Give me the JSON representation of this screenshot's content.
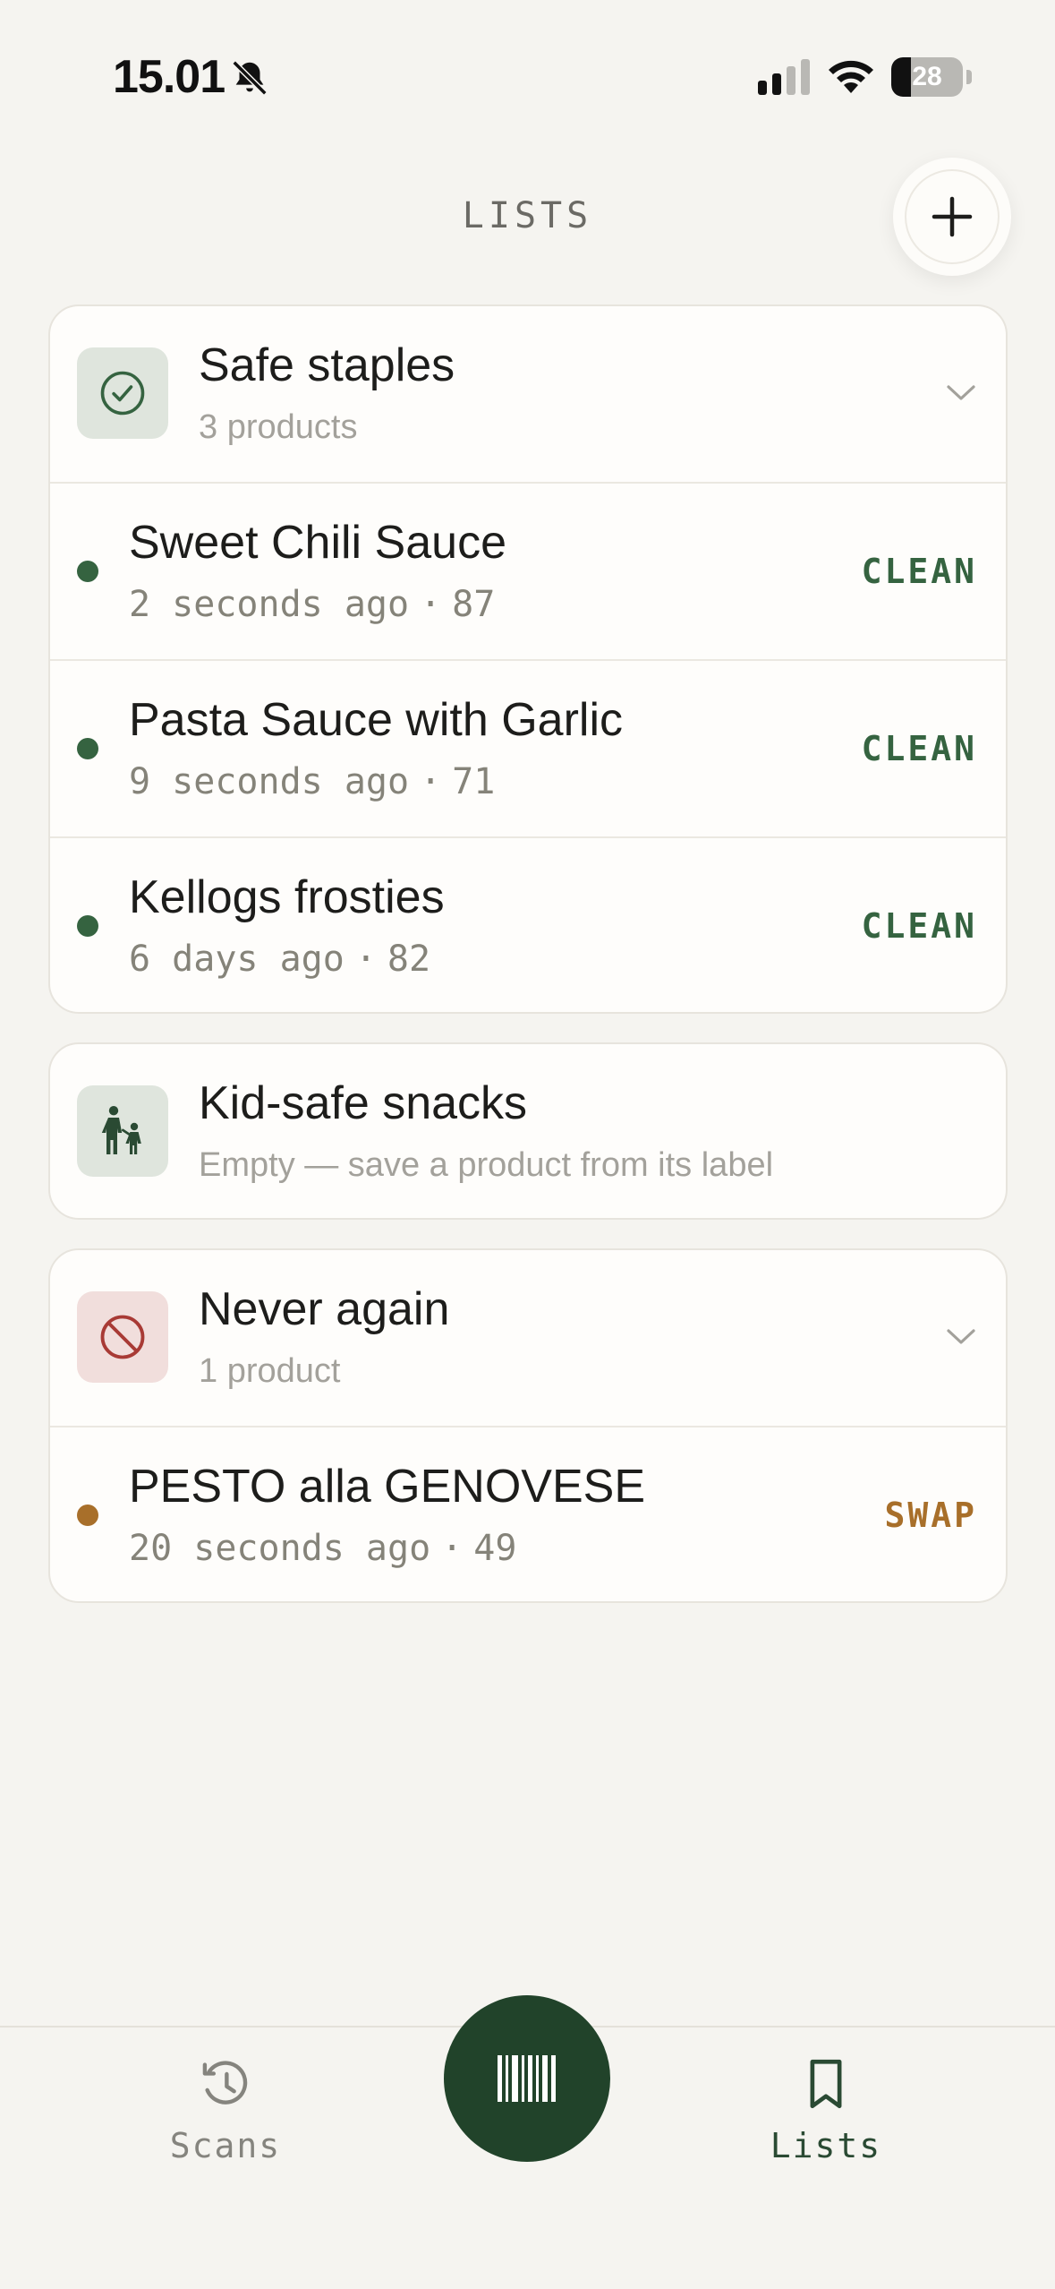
{
  "status_bar": {
    "time": "15.01",
    "battery_level": "28",
    "battery_fraction": 0.28,
    "icons": [
      "bell-slash-icon",
      "cellular-signal-icon",
      "wifi-icon",
      "battery-icon"
    ]
  },
  "header": {
    "title": "LISTS",
    "add_icon": "plus-icon"
  },
  "lists": [
    {
      "name": "Safe staples",
      "subtitle": "3 products",
      "icon": "check-circle-icon",
      "accent": "#356340",
      "expanded": true,
      "products": [
        {
          "name": "Sweet Chili Sauce",
          "time": "2 seconds ago",
          "separator": "·",
          "score": "87",
          "verdict": "CLEAN"
        },
        {
          "name": "Pasta Sauce with Garlic",
          "time": "9 seconds ago",
          "separator": "·",
          "score": "71",
          "verdict": "CLEAN"
        },
        {
          "name": "Kellogs frosties",
          "time": "6 days ago",
          "separator": "·",
          "score": "82",
          "verdict": "CLEAN"
        }
      ]
    },
    {
      "name": "Kid-safe snacks",
      "subtitle": "Empty — save a product from its label",
      "icon": "parent-child-icon",
      "accent": "#2a4a33",
      "expanded": false,
      "products": []
    },
    {
      "name": "Never again",
      "subtitle": "1 product",
      "icon": "prohibited-icon",
      "accent": "#a83a35",
      "expanded": true,
      "products": [
        {
          "name": "PESTO alla GENOVESE",
          "time": "20 seconds ago",
          "separator": "·",
          "score": "49",
          "verdict": "SWAP"
        }
      ]
    }
  ],
  "colors": {
    "clean": "#356340",
    "swap": "#a86f2a",
    "primary_dark": "#21432a",
    "background": "#f5f4f0"
  },
  "bottom_nav": {
    "scans_label": "Scans",
    "scans_icon": "history-clock-icon",
    "scan_icon": "barcode-icon",
    "lists_label": "Lists",
    "lists_icon": "bookmark-icon",
    "active": "Lists"
  }
}
